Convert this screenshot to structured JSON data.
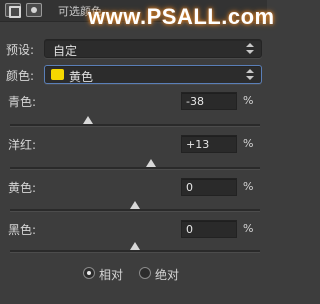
{
  "header": {
    "title": "可选颜色",
    "watermark": "www.PSALL.com"
  },
  "preset": {
    "label": "预设:",
    "value": "自定"
  },
  "color": {
    "label": "颜色:",
    "value": "黄色",
    "swatch_color": "#f5d800"
  },
  "sliders": [
    {
      "label": "青色:",
      "value": "-38",
      "unit": "%",
      "level": -38
    },
    {
      "label": "洋红:",
      "value": "+13",
      "unit": "%",
      "level": 13
    },
    {
      "label": "黄色:",
      "value": "0",
      "unit": "%",
      "level": 0
    },
    {
      "label": "黑色:",
      "value": "0",
      "unit": "%",
      "level": 0
    }
  ],
  "method": {
    "options": [
      {
        "label": "相对",
        "checked": true
      },
      {
        "label": "绝对",
        "checked": false
      }
    ]
  }
}
